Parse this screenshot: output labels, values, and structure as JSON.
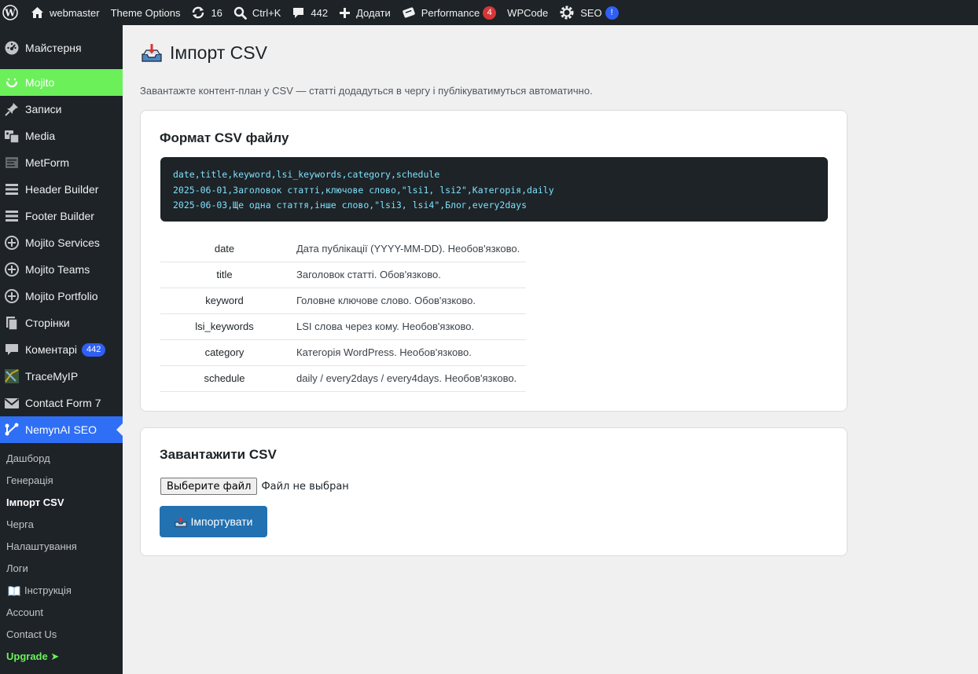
{
  "admin_bar": {
    "site_name": "webmaster",
    "theme_options": "Theme Options",
    "updates_count": "16",
    "search_shortcut": "Ctrl+K",
    "comments_count": "442",
    "add_new": "Додати",
    "performance": "Performance",
    "performance_badge": "4",
    "wpcode": "WPCode",
    "seo": "SEO",
    "seo_badge": "!"
  },
  "sidebar": {
    "items": [
      {
        "label": "Майстерня",
        "icon": "dashboard-icon"
      },
      {
        "label": "Mojito",
        "icon": "mojito-smile-icon"
      },
      {
        "label": "Записи",
        "icon": "pin-icon"
      },
      {
        "label": "Media",
        "icon": "media-icon"
      },
      {
        "label": "MetForm",
        "icon": "form-icon"
      },
      {
        "label": "Header Builder",
        "icon": "builder-icon"
      },
      {
        "label": "Footer Builder",
        "icon": "builder-icon"
      },
      {
        "label": "Mojito Services",
        "icon": "plus-circle-icon"
      },
      {
        "label": "Mojito Teams",
        "icon": "plus-circle-icon"
      },
      {
        "label": "Mojito Portfolio",
        "icon": "plus-circle-icon"
      },
      {
        "label": "Сторінки",
        "icon": "pages-icon"
      },
      {
        "label": "Коментарі",
        "icon": "comment-icon",
        "badge": "442"
      },
      {
        "label": "TraceMyIP",
        "icon": "tracemyip-icon"
      },
      {
        "label": "Contact Form 7",
        "icon": "mail-icon"
      },
      {
        "label": "NemynAI SEO",
        "icon": "nemynai-icon"
      }
    ],
    "submenu": [
      "Дашборд",
      "Генерація",
      "Імпорт CSV",
      "Черга",
      "Налаштування",
      "Логи",
      "Інструкція",
      "Account",
      "Contact Us",
      "Upgrade ➤"
    ]
  },
  "page": {
    "title": "Імпорт CSV",
    "description": "Завантажте контент-план у CSV — статті додадуться в чергу і публікуватимуться автоматично."
  },
  "format_card": {
    "title": "Формат CSV файлу",
    "code_lines": [
      "date,title,keyword,lsi_keywords,category,schedule",
      "2025-06-01,Заголовок статті,ключове слово,\"lsi1, lsi2\",Категорія,daily",
      "2025-06-03,Ще одна стаття,інше слово,\"lsi3, lsi4\",Блог,every2days"
    ],
    "fields": [
      {
        "name": "date",
        "desc": "Дата публікації (YYYY-MM-DD). Необов'язково."
      },
      {
        "name": "title",
        "desc": "Заголовок статті. Обов'язково."
      },
      {
        "name": "keyword",
        "desc": "Головне ключове слово. Обов'язково."
      },
      {
        "name": "lsi_keywords",
        "desc": "LSI слова через кому. Необов'язково."
      },
      {
        "name": "category",
        "desc": "Категорія WordPress. Необов'язково."
      },
      {
        "name": "schedule",
        "desc": "daily / every2days / every4days. Необов'язково."
      }
    ]
  },
  "upload_card": {
    "title": "Завантажити CSV",
    "file_button": "Выберите файл",
    "file_status": "Файл не выбран",
    "import_button": "Імпортувати"
  },
  "colors": {
    "adminbar_bg": "#1d2327",
    "mojito_green": "#6bf05a",
    "current_blue": "#2f6ff5",
    "primary_button": "#2271b1",
    "code_text": "#7ee0fb"
  }
}
